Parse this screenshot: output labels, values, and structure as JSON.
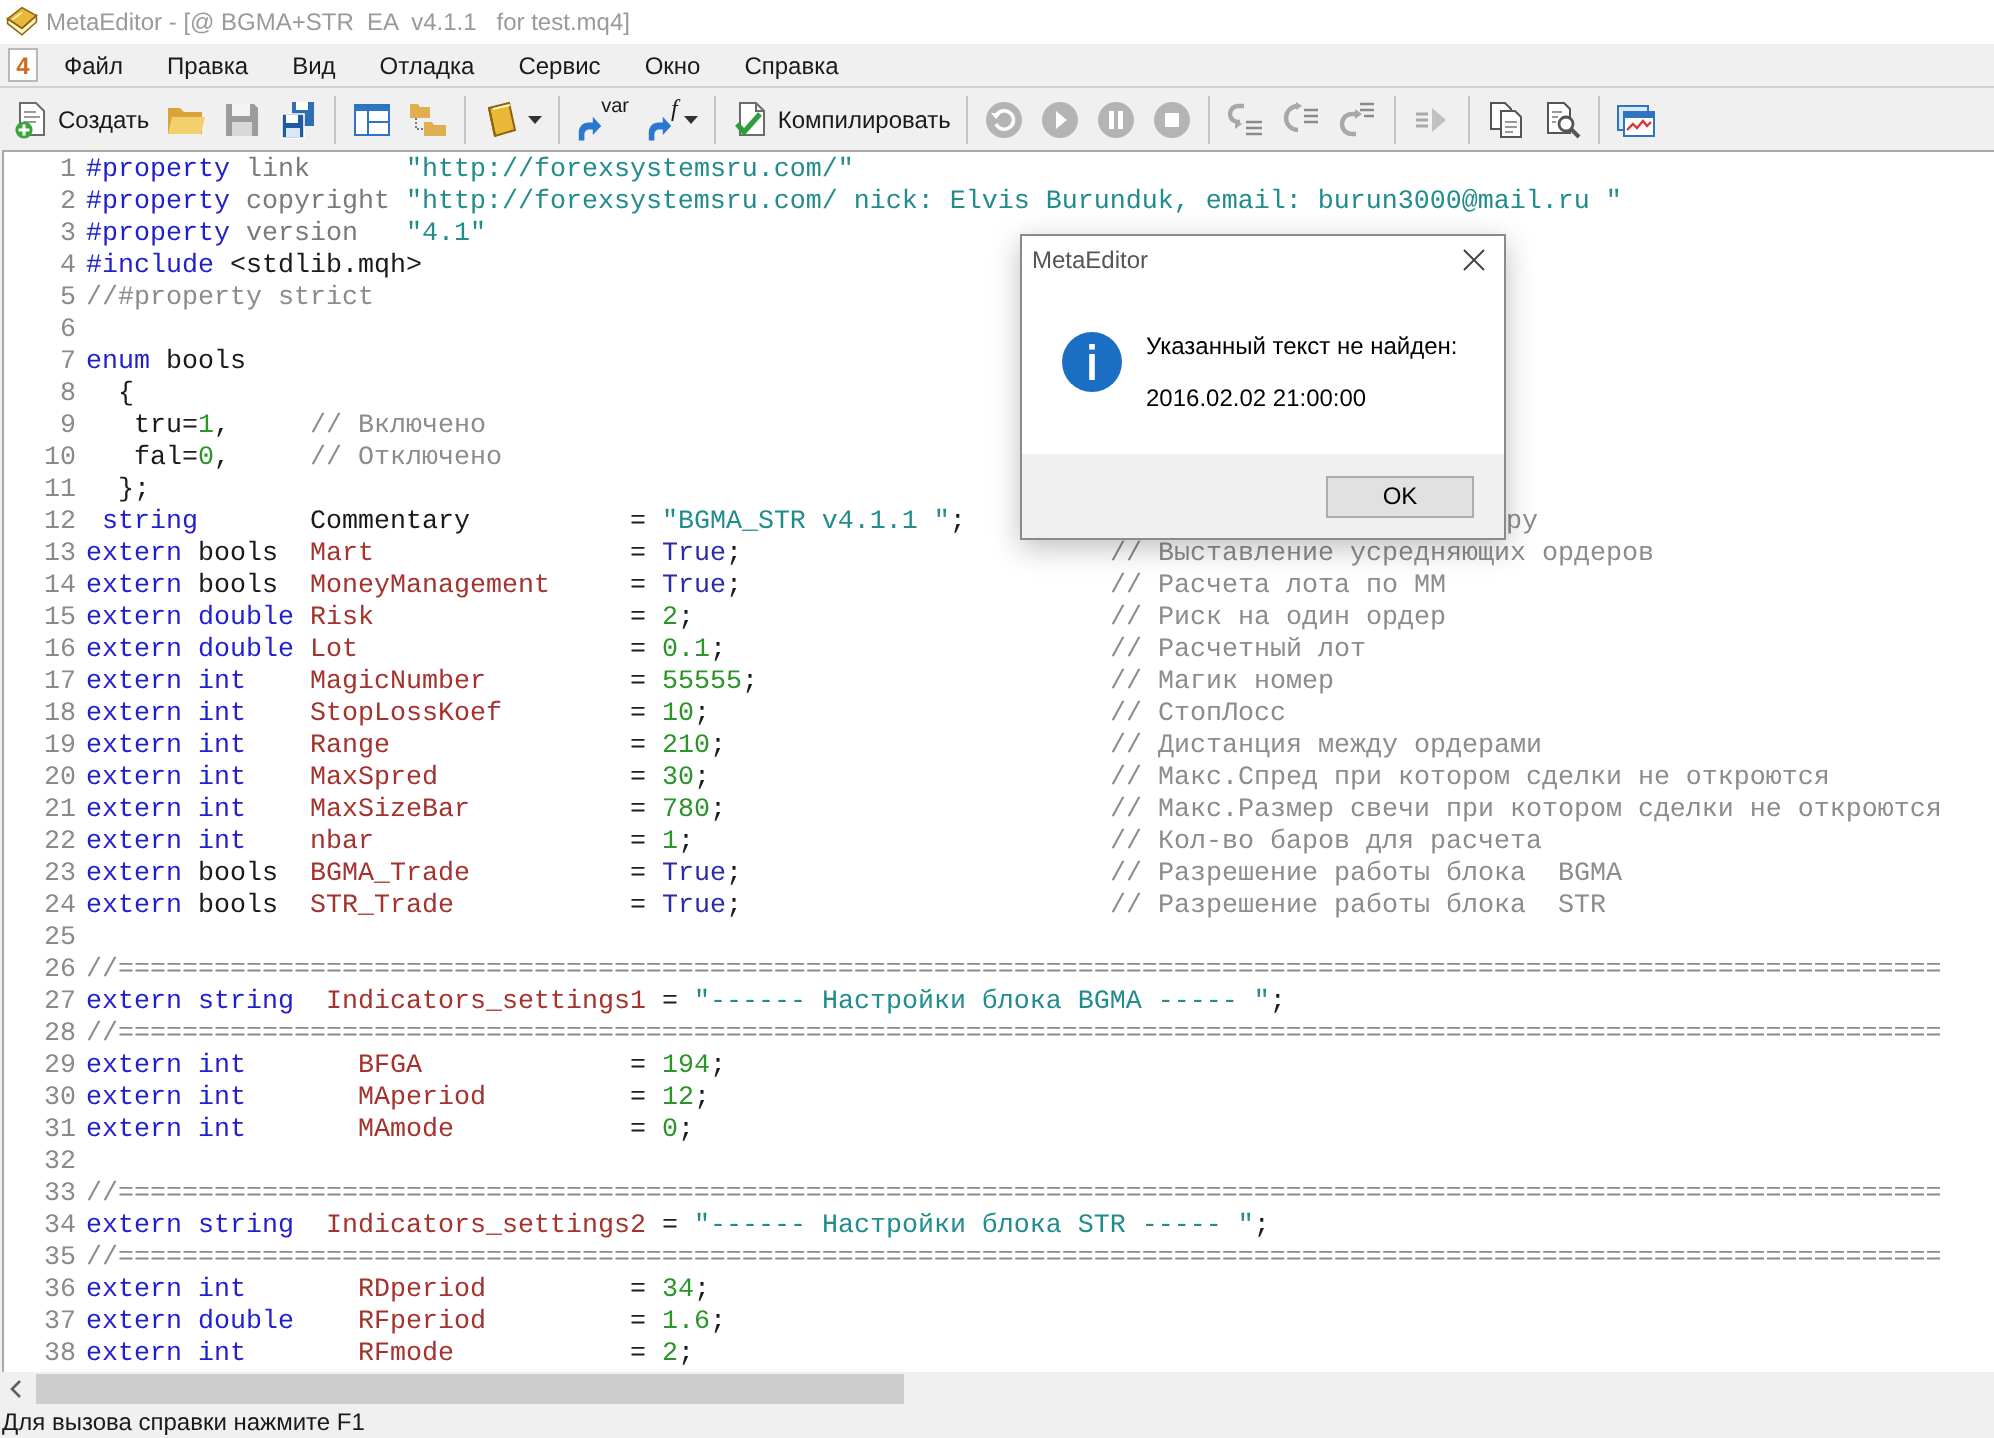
{
  "window": {
    "title": "MetaEditor - [@ BGMA+STR  EA  v4.1.1   for test.mq4]"
  },
  "menu": {
    "app_icon_label": "4",
    "items": [
      "Файл",
      "Правка",
      "Вид",
      "Отладка",
      "Сервис",
      "Окно",
      "Справка"
    ]
  },
  "toolbar": [
    [
      {
        "label": "Создать",
        "disabled": false
      },
      {
        "disabled": false
      },
      {
        "disabled": true
      },
      {
        "disabled": false
      }
    ],
    [
      {
        "disabled": false
      },
      {
        "disabled": false
      }
    ],
    [
      {
        "disabled": false,
        "dropdown": true
      }
    ],
    [
      {
        "icon_text": "var",
        "disabled": false
      },
      {
        "icon_text": "f",
        "disabled": false,
        "dropdown": true
      }
    ],
    [
      {
        "label": "Компилировать",
        "disabled": false
      }
    ],
    [
      {
        "disabled": true
      },
      {
        "disabled": true
      },
      {
        "disabled": true
      },
      {
        "disabled": true
      }
    ],
    [
      {
        "disabled": true
      },
      {
        "disabled": true
      },
      {
        "disabled": true
      }
    ],
    [
      {
        "disabled": true
      }
    ],
    [
      {
        "disabled": false
      },
      {
        "disabled": false
      }
    ],
    [
      {
        "disabled": false
      }
    ]
  ],
  "editor": {
    "lines": [
      {
        "number": "1",
        "tokens": [
          {
            "kind": "keyword",
            "text": "#property"
          },
          {
            "kind": "property",
            "text": " link"
          },
          {
            "kind": "string",
            "text": "      \"http://forexsystemsru.com/\""
          }
        ]
      },
      {
        "number": "2",
        "tokens": [
          {
            "kind": "keyword",
            "text": "#property"
          },
          {
            "kind": "property",
            "text": " copyright"
          },
          {
            "kind": "string",
            "text": " \"http://forexsystemsru.com/ nick: Elvis Burunduk, email: burun3000@mail.ru \""
          }
        ]
      },
      {
        "number": "3",
        "tokens": [
          {
            "kind": "keyword",
            "text": "#property"
          },
          {
            "kind": "property",
            "text": " version"
          },
          {
            "kind": "string",
            "text": "   \"4.1\""
          }
        ]
      },
      {
        "number": "4",
        "tokens": [
          {
            "kind": "keyword",
            "text": "#include"
          },
          {
            "kind": "text",
            "text": " <stdlib.mqh>"
          }
        ]
      },
      {
        "number": "5",
        "tokens": [
          {
            "kind": "comment",
            "text": "//#property strict"
          }
        ]
      },
      {
        "number": "6"
      },
      {
        "number": "7",
        "tokens": [
          {
            "kind": "keyword",
            "text": "enum"
          },
          {
            "kind": "text",
            "text": " bools"
          }
        ]
      },
      {
        "number": "8",
        "tokens": [
          {
            "kind": "text",
            "text": "  {"
          }
        ]
      },
      {
        "number": "9",
        "tokens": [
          {
            "kind": "text",
            "text": "   tru="
          },
          {
            "kind": "number",
            "text": "1"
          },
          {
            "kind": "text",
            "text": ","
          }
        ],
        "comment": {
          "kind": "inline",
          "text": "// Включено"
        }
      },
      {
        "number": "10",
        "tokens": [
          {
            "kind": "text",
            "text": "   fal="
          },
          {
            "kind": "number",
            "text": "0"
          },
          {
            "kind": "text",
            "text": ","
          }
        ],
        "comment": {
          "kind": "inline",
          "text": "// Отключено"
        }
      },
      {
        "number": "11",
        "tokens": [
          {
            "kind": "text",
            "text": "  };"
          }
        ]
      },
      {
        "number": "12",
        "tokens": [
          {
            "kind": "keyword",
            "text": " string"
          },
          {
            "kind": "text",
            "text": "       Commentary          ="
          },
          {
            "kind": "string",
            "text": " \"BGMA_STR v4.1.1 \""
          },
          {
            "kind": "text",
            "text": ";"
          }
        ],
        "comment": {
          "kind": "covered",
          "text": "ру"
        }
      },
      {
        "number": "13",
        "tokens": [
          {
            "kind": "keyword",
            "text": "extern"
          },
          {
            "kind": "text",
            "text": " bools"
          },
          {
            "kind": "identifier",
            "text": "  Mart"
          },
          {
            "kind": "text",
            "text": "                ="
          },
          {
            "kind": "constant",
            "text": " True"
          },
          {
            "kind": "text",
            "text": ";"
          }
        ],
        "comment": {
          "kind": "column",
          "text": "// Выставление усредняющих ордеров"
        }
      },
      {
        "number": "14",
        "tokens": [
          {
            "kind": "keyword",
            "text": "extern"
          },
          {
            "kind": "text",
            "text": " bools"
          },
          {
            "kind": "identifier",
            "text": "  MoneyManagement"
          },
          {
            "kind": "text",
            "text": "     ="
          },
          {
            "kind": "constant",
            "text": " True"
          },
          {
            "kind": "text",
            "text": ";"
          }
        ],
        "comment": {
          "kind": "column",
          "text": "// Расчета лота по ММ"
        }
      },
      {
        "number": "15",
        "tokens": [
          {
            "kind": "keyword",
            "text": "extern"
          },
          {
            "kind": "keyword",
            "text": " double"
          },
          {
            "kind": "identifier",
            "text": " Risk"
          },
          {
            "kind": "text",
            "text": "                ="
          },
          {
            "kind": "number",
            "text": " 2"
          },
          {
            "kind": "text",
            "text": ";"
          }
        ],
        "comment": {
          "kind": "column",
          "text": "// Риск на один ордер"
        }
      },
      {
        "number": "16",
        "tokens": [
          {
            "kind": "keyword",
            "text": "extern"
          },
          {
            "kind": "keyword",
            "text": " double"
          },
          {
            "kind": "identifier",
            "text": " Lot"
          },
          {
            "kind": "text",
            "text": "                 ="
          },
          {
            "kind": "number",
            "text": " 0.1"
          },
          {
            "kind": "text",
            "text": ";"
          }
        ],
        "comment": {
          "kind": "column",
          "text": "// Расчетный лот"
        }
      },
      {
        "number": "17",
        "tokens": [
          {
            "kind": "keyword",
            "text": "extern"
          },
          {
            "kind": "keyword",
            "text": " int"
          },
          {
            "kind": "identifier",
            "text": "    MagicNumber"
          },
          {
            "kind": "text",
            "text": "         ="
          },
          {
            "kind": "number",
            "text": " 55555"
          },
          {
            "kind": "text",
            "text": ";"
          }
        ],
        "comment": {
          "kind": "column",
          "text": "// Магик номер"
        }
      },
      {
        "number": "18",
        "tokens": [
          {
            "kind": "keyword",
            "text": "extern"
          },
          {
            "kind": "keyword",
            "text": " int"
          },
          {
            "kind": "identifier",
            "text": "    StopLossKoef"
          },
          {
            "kind": "text",
            "text": "        ="
          },
          {
            "kind": "number",
            "text": " 10"
          },
          {
            "kind": "text",
            "text": ";"
          }
        ],
        "comment": {
          "kind": "column",
          "text": "// СтопЛосс"
        }
      },
      {
        "number": "19",
        "tokens": [
          {
            "kind": "keyword",
            "text": "extern"
          },
          {
            "kind": "keyword",
            "text": " int"
          },
          {
            "kind": "identifier",
            "text": "    Range"
          },
          {
            "kind": "text",
            "text": "               ="
          },
          {
            "kind": "number",
            "text": " 210"
          },
          {
            "kind": "text",
            "text": ";"
          }
        ],
        "comment": {
          "kind": "column",
          "text": "// Дистанция между ордерами"
        }
      },
      {
        "number": "20",
        "tokens": [
          {
            "kind": "keyword",
            "text": "extern"
          },
          {
            "kind": "keyword",
            "text": " int"
          },
          {
            "kind": "identifier",
            "text": "    MaxSpred"
          },
          {
            "kind": "text",
            "text": "            ="
          },
          {
            "kind": "number",
            "text": " 30"
          },
          {
            "kind": "text",
            "text": ";"
          }
        ],
        "comment": {
          "kind": "column",
          "text": "// Макс.Спред при котором сделки не откроются"
        }
      },
      {
        "number": "21",
        "tokens": [
          {
            "kind": "keyword",
            "text": "extern"
          },
          {
            "kind": "keyword",
            "text": " int"
          },
          {
            "kind": "identifier",
            "text": "    MaxSizeBar"
          },
          {
            "kind": "text",
            "text": "          ="
          },
          {
            "kind": "number",
            "text": " 780"
          },
          {
            "kind": "text",
            "text": ";"
          }
        ],
        "comment": {
          "kind": "column",
          "text": "// Макс.Размер свечи при котором сделки не откроются"
        }
      },
      {
        "number": "22",
        "tokens": [
          {
            "kind": "keyword",
            "text": "extern"
          },
          {
            "kind": "keyword",
            "text": " int"
          },
          {
            "kind": "identifier",
            "text": "    nbar"
          },
          {
            "kind": "text",
            "text": "                ="
          },
          {
            "kind": "number",
            "text": " 1"
          },
          {
            "kind": "text",
            "text": ";"
          }
        ],
        "comment": {
          "kind": "column",
          "text": "// Кол-во баров для расчета"
        }
      },
      {
        "number": "23",
        "tokens": [
          {
            "kind": "keyword",
            "text": "extern"
          },
          {
            "kind": "text",
            "text": " bools"
          },
          {
            "kind": "identifier",
            "text": "  BGMA_Trade"
          },
          {
            "kind": "text",
            "text": "          ="
          },
          {
            "kind": "constant",
            "text": " True"
          },
          {
            "kind": "text",
            "text": ";"
          }
        ],
        "comment": {
          "kind": "column",
          "text": "// Разрешение работы блока  BGMA"
        }
      },
      {
        "number": "24",
        "tokens": [
          {
            "kind": "keyword",
            "text": "extern"
          },
          {
            "kind": "text",
            "text": " bools"
          },
          {
            "kind": "identifier",
            "text": "  STR_Trade"
          },
          {
            "kind": "text",
            "text": "           ="
          },
          {
            "kind": "constant",
            "text": " True"
          },
          {
            "kind": "text",
            "text": ";"
          }
        ],
        "comment": {
          "kind": "column",
          "text": "// Разрешение работы блока  STR"
        }
      },
      {
        "number": "25"
      },
      {
        "number": "26",
        "tokens": [
          {
            "kind": "comment",
            "text": "//=================================================================================================================="
          }
        ]
      },
      {
        "number": "27",
        "tokens": [
          {
            "kind": "keyword",
            "text": "extern"
          },
          {
            "kind": "keyword",
            "text": " string"
          },
          {
            "kind": "identifier",
            "text": "  Indicators_settings1"
          },
          {
            "kind": "text",
            "text": " ="
          },
          {
            "kind": "string",
            "text": " \"------ Настройки блока BGMA ----- \""
          },
          {
            "kind": "text",
            "text": ";"
          }
        ]
      },
      {
        "number": "28",
        "tokens": [
          {
            "kind": "comment",
            "text": "//=================================================================================================================="
          }
        ]
      },
      {
        "number": "29",
        "tokens": [
          {
            "kind": "keyword",
            "text": "extern"
          },
          {
            "kind": "keyword",
            "text": " int"
          },
          {
            "kind": "identifier",
            "text": "       BFGA"
          },
          {
            "kind": "text",
            "text": "             ="
          },
          {
            "kind": "number",
            "text": " 194"
          },
          {
            "kind": "text",
            "text": ";"
          }
        ]
      },
      {
        "number": "30",
        "tokens": [
          {
            "kind": "keyword",
            "text": "extern"
          },
          {
            "kind": "keyword",
            "text": " int"
          },
          {
            "kind": "identifier",
            "text": "       MAperiod"
          },
          {
            "kind": "text",
            "text": "         ="
          },
          {
            "kind": "number",
            "text": " 12"
          },
          {
            "kind": "text",
            "text": ";"
          }
        ]
      },
      {
        "number": "31",
        "tokens": [
          {
            "kind": "keyword",
            "text": "extern"
          },
          {
            "kind": "keyword",
            "text": " int"
          },
          {
            "kind": "identifier",
            "text": "       MAmode"
          },
          {
            "kind": "text",
            "text": "           ="
          },
          {
            "kind": "number",
            "text": " 0"
          },
          {
            "kind": "text",
            "text": ";"
          }
        ]
      },
      {
        "number": "32"
      },
      {
        "number": "33",
        "tokens": [
          {
            "kind": "comment",
            "text": "//=================================================================================================================="
          }
        ]
      },
      {
        "number": "34",
        "tokens": [
          {
            "kind": "keyword",
            "text": "extern"
          },
          {
            "kind": "keyword",
            "text": " string"
          },
          {
            "kind": "identifier",
            "text": "  Indicators_settings2"
          },
          {
            "kind": "text",
            "text": " ="
          },
          {
            "kind": "string",
            "text": " \"------ Настройки блока STR ----- \""
          },
          {
            "kind": "text",
            "text": ";"
          }
        ]
      },
      {
        "number": "35",
        "tokens": [
          {
            "kind": "comment",
            "text": "//=================================================================================================================="
          }
        ]
      },
      {
        "number": "36",
        "tokens": [
          {
            "kind": "keyword",
            "text": "extern"
          },
          {
            "kind": "keyword",
            "text": " int"
          },
          {
            "kind": "identifier",
            "text": "       RDperiod"
          },
          {
            "kind": "text",
            "text": "         ="
          },
          {
            "kind": "number",
            "text": " 34"
          },
          {
            "kind": "text",
            "text": ";"
          }
        ]
      },
      {
        "number": "37",
        "tokens": [
          {
            "kind": "keyword",
            "text": "extern"
          },
          {
            "kind": "keyword",
            "text": " double"
          },
          {
            "kind": "identifier",
            "text": "    RFperiod"
          },
          {
            "kind": "text",
            "text": "         ="
          },
          {
            "kind": "number",
            "text": " 1.6"
          },
          {
            "kind": "text",
            "text": ";"
          }
        ]
      },
      {
        "number": "38",
        "tokens": [
          {
            "kind": "keyword",
            "text": "extern"
          },
          {
            "kind": "keyword",
            "text": " int"
          },
          {
            "kind": "identifier",
            "text": "       RFmode"
          },
          {
            "kind": "text",
            "text": "           ="
          },
          {
            "kind": "number",
            "text": " 2"
          },
          {
            "kind": "text",
            "text": ";"
          }
        ]
      }
    ]
  },
  "dialog": {
    "title": "MetaEditor",
    "message": "Указанный текст не найден:",
    "detail": "2016.02.02 21:00:00",
    "button": "OK"
  },
  "status_bar": {
    "text": "Для вызова справки нажмите F1"
  }
}
